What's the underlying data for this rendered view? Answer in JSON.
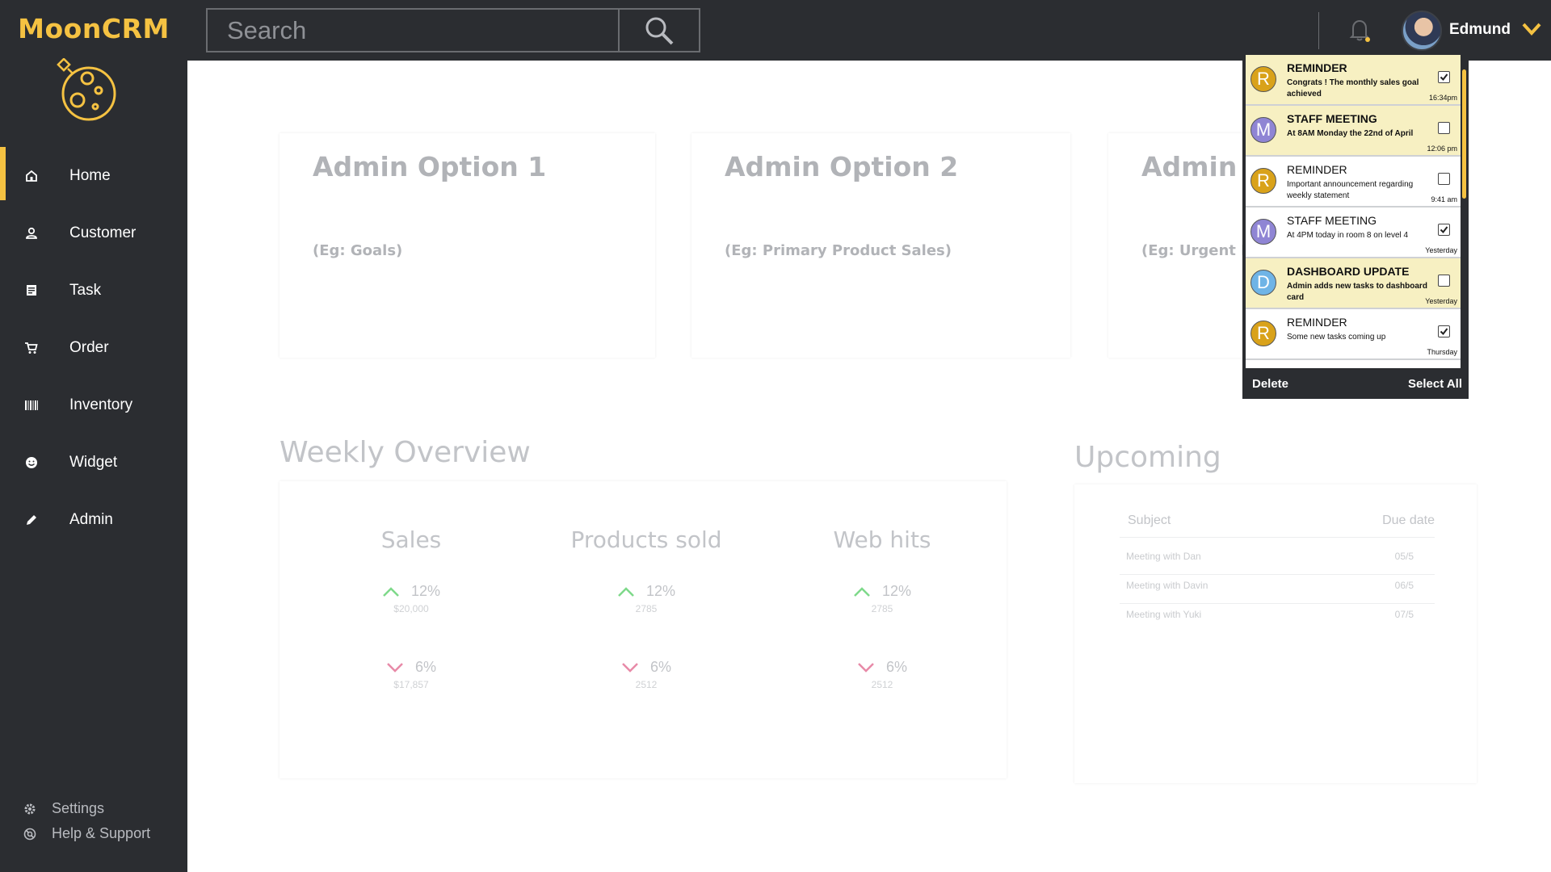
{
  "app": {
    "name": "MoonCRM",
    "accent": "#f5c242",
    "chrome": "#2b2d31"
  },
  "sidebar": {
    "items": [
      {
        "label": "Home",
        "icon": "home-icon",
        "active": true
      },
      {
        "label": "Customer",
        "icon": "user-icon"
      },
      {
        "label": "Task",
        "icon": "task-icon"
      },
      {
        "label": "Order",
        "icon": "cart-icon"
      },
      {
        "label": "Inventory",
        "icon": "barcode-icon"
      },
      {
        "label": "Widget",
        "icon": "smiley-icon"
      },
      {
        "label": "Admin",
        "icon": "pencil-icon"
      }
    ],
    "bottom": [
      {
        "label": "Settings",
        "icon": "gear-icon"
      },
      {
        "label": "Help & Support",
        "icon": "lifebuoy-icon"
      }
    ]
  },
  "topbar": {
    "search_placeholder": "Search",
    "username": "Edmund"
  },
  "cards": [
    {
      "title": "Admin Option 1",
      "subtitle": "(Eg: Goals)"
    },
    {
      "title": "Admin Option 2",
      "subtitle": "(Eg: Primary Product Sales)"
    },
    {
      "title": "Admin O",
      "subtitle": "(Eg: Urgent No"
    }
  ],
  "weekly": {
    "title": "Weekly Overview",
    "metrics": [
      {
        "title": "Sales",
        "up_pct": "12%",
        "up_val": "$20,000",
        "down_pct": "6%",
        "down_val": "$17,857"
      },
      {
        "title": "Products sold",
        "up_pct": "12%",
        "up_val": "2785",
        "down_pct": "6%",
        "down_val": "2512"
      },
      {
        "title": "Web hits",
        "up_pct": "12%",
        "up_val": "2785",
        "down_pct": "6%",
        "down_val": "2512"
      }
    ],
    "up_color": "#7ed98a",
    "down_color": "#e88aa8"
  },
  "upcoming": {
    "title": "Upcoming",
    "col_subject": "Subject",
    "col_due": "Due date",
    "rows": [
      {
        "subject": "Meeting with Dan",
        "due": "05/5"
      },
      {
        "subject": "Meeting with Davin",
        "due": "06/5"
      },
      {
        "subject": "Meeting with Yuki",
        "due": "07/5"
      }
    ]
  },
  "notifications": {
    "items": [
      {
        "letter": "R",
        "color": "#d9a21a",
        "title": "REMINDER",
        "message": "Congrats ! The monthly sales goal achieved",
        "time": "16:34pm",
        "checked": true,
        "unread": true
      },
      {
        "letter": "M",
        "color": "#8f85d4",
        "title": "STAFF MEETING",
        "message": "At 8AM Monday the 22nd of April",
        "time": "12:06 pm",
        "checked": false,
        "unread": true
      },
      {
        "letter": "R",
        "color": "#d9a21a",
        "title": "REMINDER",
        "message": "Important announcement regarding weekly statement",
        "time": "9:41 am",
        "checked": false,
        "unread": false
      },
      {
        "letter": "M",
        "color": "#8f85d4",
        "title": "STAFF MEETING",
        "message": "At 4PM today in room 8 on level 4",
        "time": "Yesterday",
        "checked": true,
        "unread": false
      },
      {
        "letter": "D",
        "color": "#6fb4e6",
        "title": "DASHBOARD UPDATE",
        "message": "Admin adds new tasks to dashboard card",
        "time": "Yesterday",
        "checked": false,
        "unread": true
      },
      {
        "letter": "R",
        "color": "#d9a21a",
        "title": "REMINDER",
        "message": "Some new tasks coming up",
        "time": "Thursday",
        "checked": true,
        "unread": false
      }
    ],
    "delete_label": "Delete",
    "select_all_label": "Select All"
  }
}
